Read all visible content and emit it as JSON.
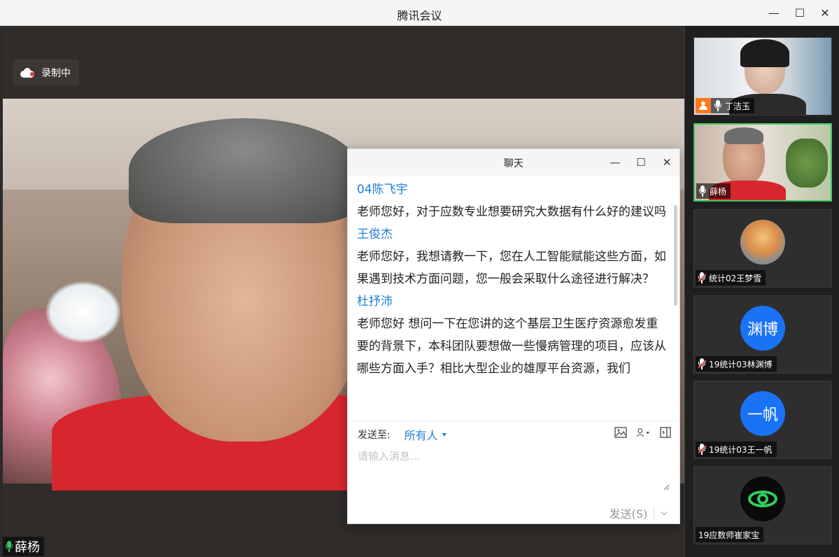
{
  "window": {
    "title": "腾讯会议",
    "minimize_label": "—",
    "maximize_label": "☐",
    "close_label": "✕"
  },
  "stage": {
    "recording_label": "录制中",
    "speaker_name": "薛杨"
  },
  "chat": {
    "title": "聊天",
    "messages": [
      {
        "sender": "04陈飞宇",
        "text": "老师您好，对于应数专业想要研究大数据有什么好的建议吗"
      },
      {
        "sender": "王俊杰",
        "text": "老师您好，我想请教一下，您在人工智能赋能这些方面，如果遇到技术方面问题，您一般会采取什么途径进行解决？"
      },
      {
        "sender": "杜抒沛",
        "text": "老师您好 想问一下在您讲的这个基层卫生医疗资源愈发重要的背景下，本科团队要想做一些慢病管理的项目，应该从哪些方面入手？相比大型企业的雄厚平台资源，我们"
      }
    ],
    "send_to_label": "发送至:",
    "send_to_value": "所有人",
    "input_placeholder": "请输入消息...",
    "send_button": "发送(S)"
  },
  "participants": [
    {
      "name": "丁洁玉",
      "type": "video",
      "host": true,
      "muted": false
    },
    {
      "name": "薛杨",
      "type": "video",
      "active": true,
      "muted": false
    },
    {
      "name": "统计02王梦雪",
      "type": "avatar-image",
      "muted": true
    },
    {
      "name": "19统计03林渊博",
      "type": "avatar-text",
      "avatar_text": "渊博",
      "avatar_color": "#1a73f5",
      "muted": true
    },
    {
      "name": "19统计03王一帆",
      "type": "avatar-text",
      "avatar_text": "一帆",
      "avatar_color": "#1a73f5",
      "muted": true
    },
    {
      "name": "19应数师崔家宝",
      "type": "avatar-icon",
      "icon": "eye-icon"
    }
  ],
  "colors": {
    "accent_blue": "#1e7fd6",
    "active_green": "#3cc864",
    "muted_red": "#ff4b4b",
    "host_orange": "#ff7a1a"
  }
}
